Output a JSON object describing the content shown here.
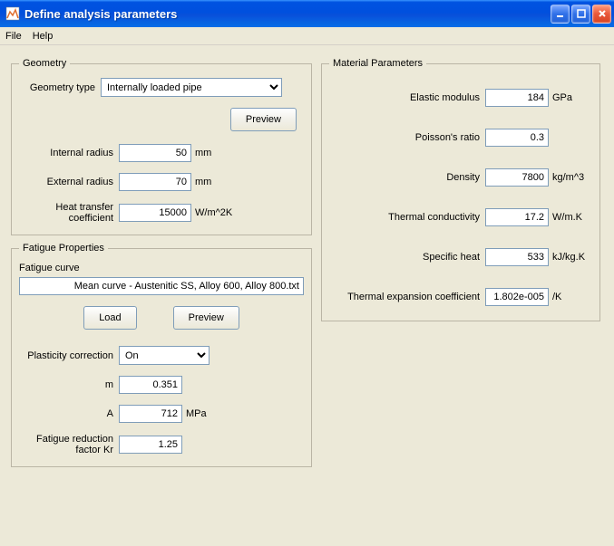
{
  "window": {
    "title": "Define analysis parameters"
  },
  "menu": {
    "file": "File",
    "help": "Help"
  },
  "geometry": {
    "legend": "Geometry",
    "type_label": "Geometry type",
    "type_value": "Internally loaded pipe",
    "preview_btn": "Preview",
    "internal_radius_label": "Internal radius",
    "internal_radius_value": "50",
    "internal_radius_unit": "mm",
    "external_radius_label": "External radius",
    "external_radius_value": "70",
    "external_radius_unit": "mm",
    "htc_label": "Heat transfer coefficient",
    "htc_value": "15000",
    "htc_unit": "W/m^2K"
  },
  "fatigue": {
    "legend": "Fatigue Properties",
    "curve_label": "Fatigue curve",
    "curve_value": "Mean curve - Austenitic SS, Alloy 600, Alloy 800.txt",
    "load_btn": "Load",
    "preview_btn": "Preview",
    "plasticity_label": "Plasticity correction",
    "plasticity_value": "On",
    "m_label": "m",
    "m_value": "0.351",
    "a_label": "A",
    "a_value": "712",
    "a_unit": "MPa",
    "krf_label": "Fatigue reduction factor Kr",
    "krf_value": "1.25"
  },
  "material": {
    "legend": "Material Parameters",
    "elastic_label": "Elastic modulus",
    "elastic_value": "184",
    "elastic_unit": "GPa",
    "poisson_label": "Poisson's ratio",
    "poisson_value": "0.3",
    "poisson_unit": "",
    "density_label": "Density",
    "density_value": "7800",
    "density_unit": "kg/m^3",
    "tc_label": "Thermal conductivity",
    "tc_value": "17.2",
    "tc_unit": "W/m.K",
    "sh_label": "Specific heat",
    "sh_value": "533",
    "sh_unit": "kJ/kg.K",
    "tec_label": "Thermal expansion coefficient",
    "tec_value": "1.802e-005",
    "tec_unit": "/K"
  }
}
